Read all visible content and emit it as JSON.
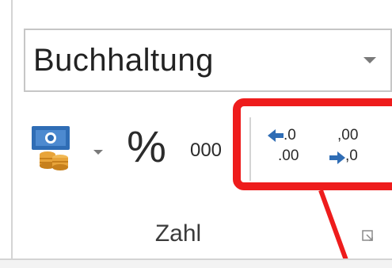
{
  "format_select": {
    "value": "Buchhaltung",
    "icon": "chevron-down-icon"
  },
  "buttons": {
    "currency": {
      "icon": "accounting-currency-icon"
    },
    "percent": {
      "label": "%"
    },
    "thousands": {
      "label": "000"
    },
    "increase_decimal": {
      "line1": ".0",
      "line2": ".00",
      "icon": "arrow-left-icon"
    },
    "decrease_decimal": {
      "line1": ",00",
      "line2": ",0",
      "icon": "arrow-right-icon"
    }
  },
  "group": {
    "label": "Zahl",
    "launcher_icon": "dialog-launcher-icon"
  },
  "colors": {
    "highlight": "#ee1c1c",
    "accent_blue": "#2f6db5",
    "coin_gold": "#e8a43a"
  }
}
